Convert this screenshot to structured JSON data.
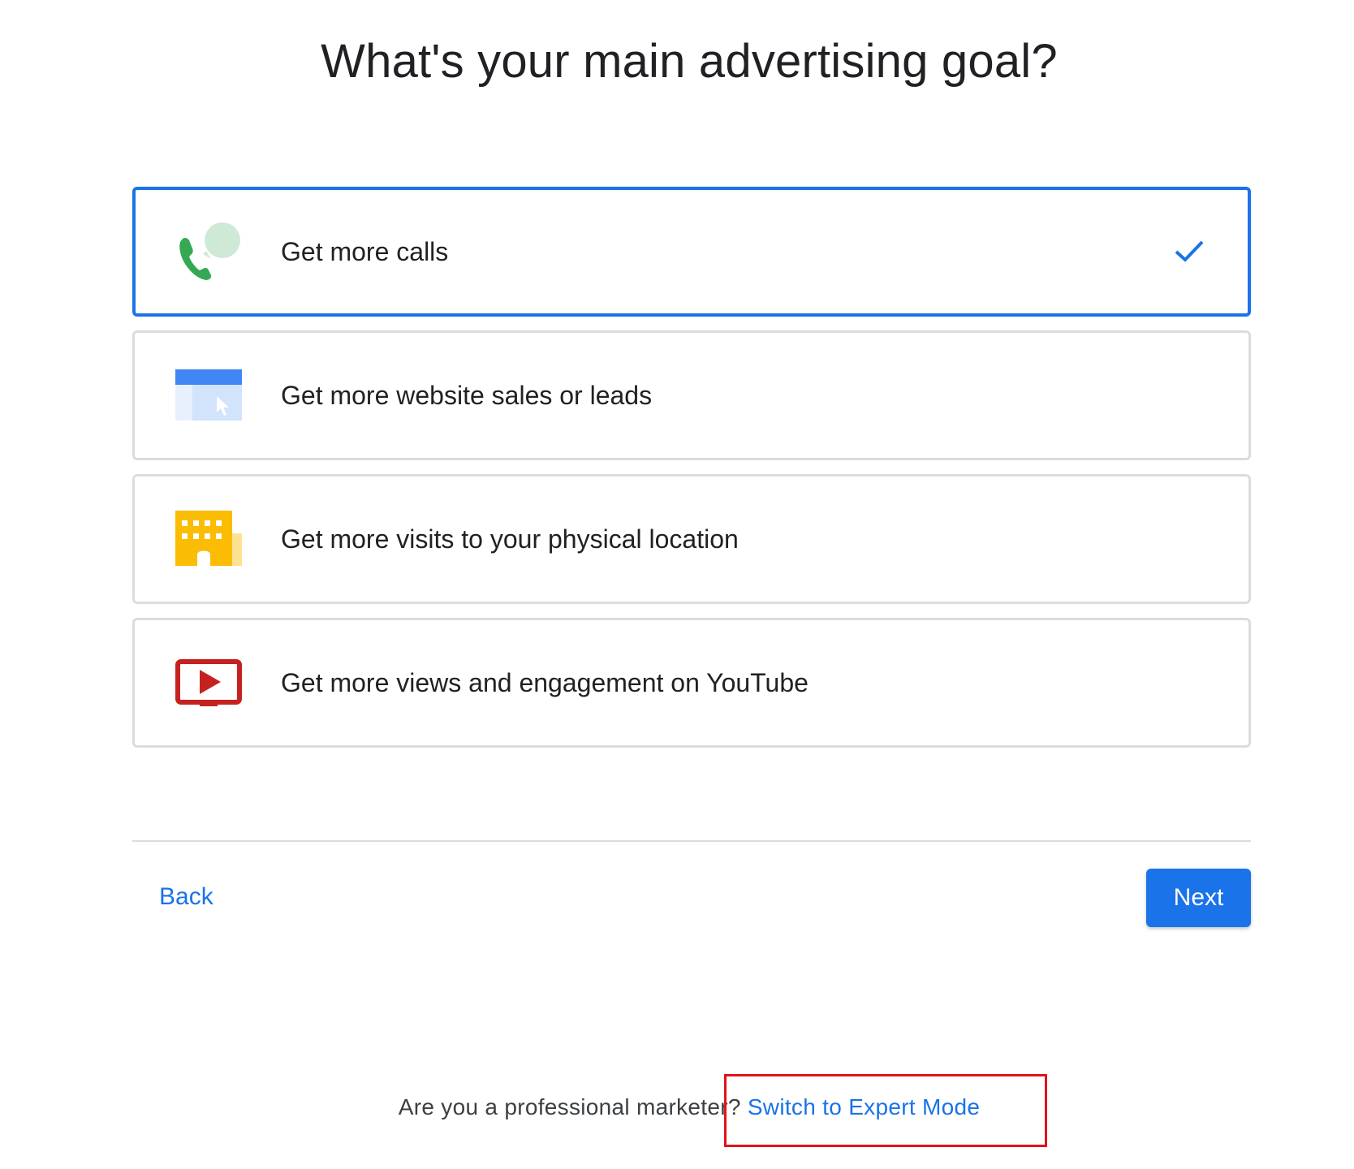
{
  "title": "What's your main advertising goal?",
  "options": [
    {
      "label": "Get more calls",
      "icon": "phone-chat-icon",
      "selected": true
    },
    {
      "label": "Get more website sales or leads",
      "icon": "browser-cursor-icon",
      "selected": false
    },
    {
      "label": "Get more visits to your physical location",
      "icon": "building-storefront-icon",
      "selected": false
    },
    {
      "label": "Get more views and engagement on YouTube",
      "icon": "youtube-play-icon",
      "selected": false
    }
  ],
  "nav": {
    "back_label": "Back",
    "next_label": "Next"
  },
  "footer": {
    "question": "Are you a professional marketer? ",
    "link_label": "Switch to Expert Mode"
  },
  "colors": {
    "accent": "#1a73e8",
    "highlight": "#e3131b",
    "border": "#dadce0"
  }
}
